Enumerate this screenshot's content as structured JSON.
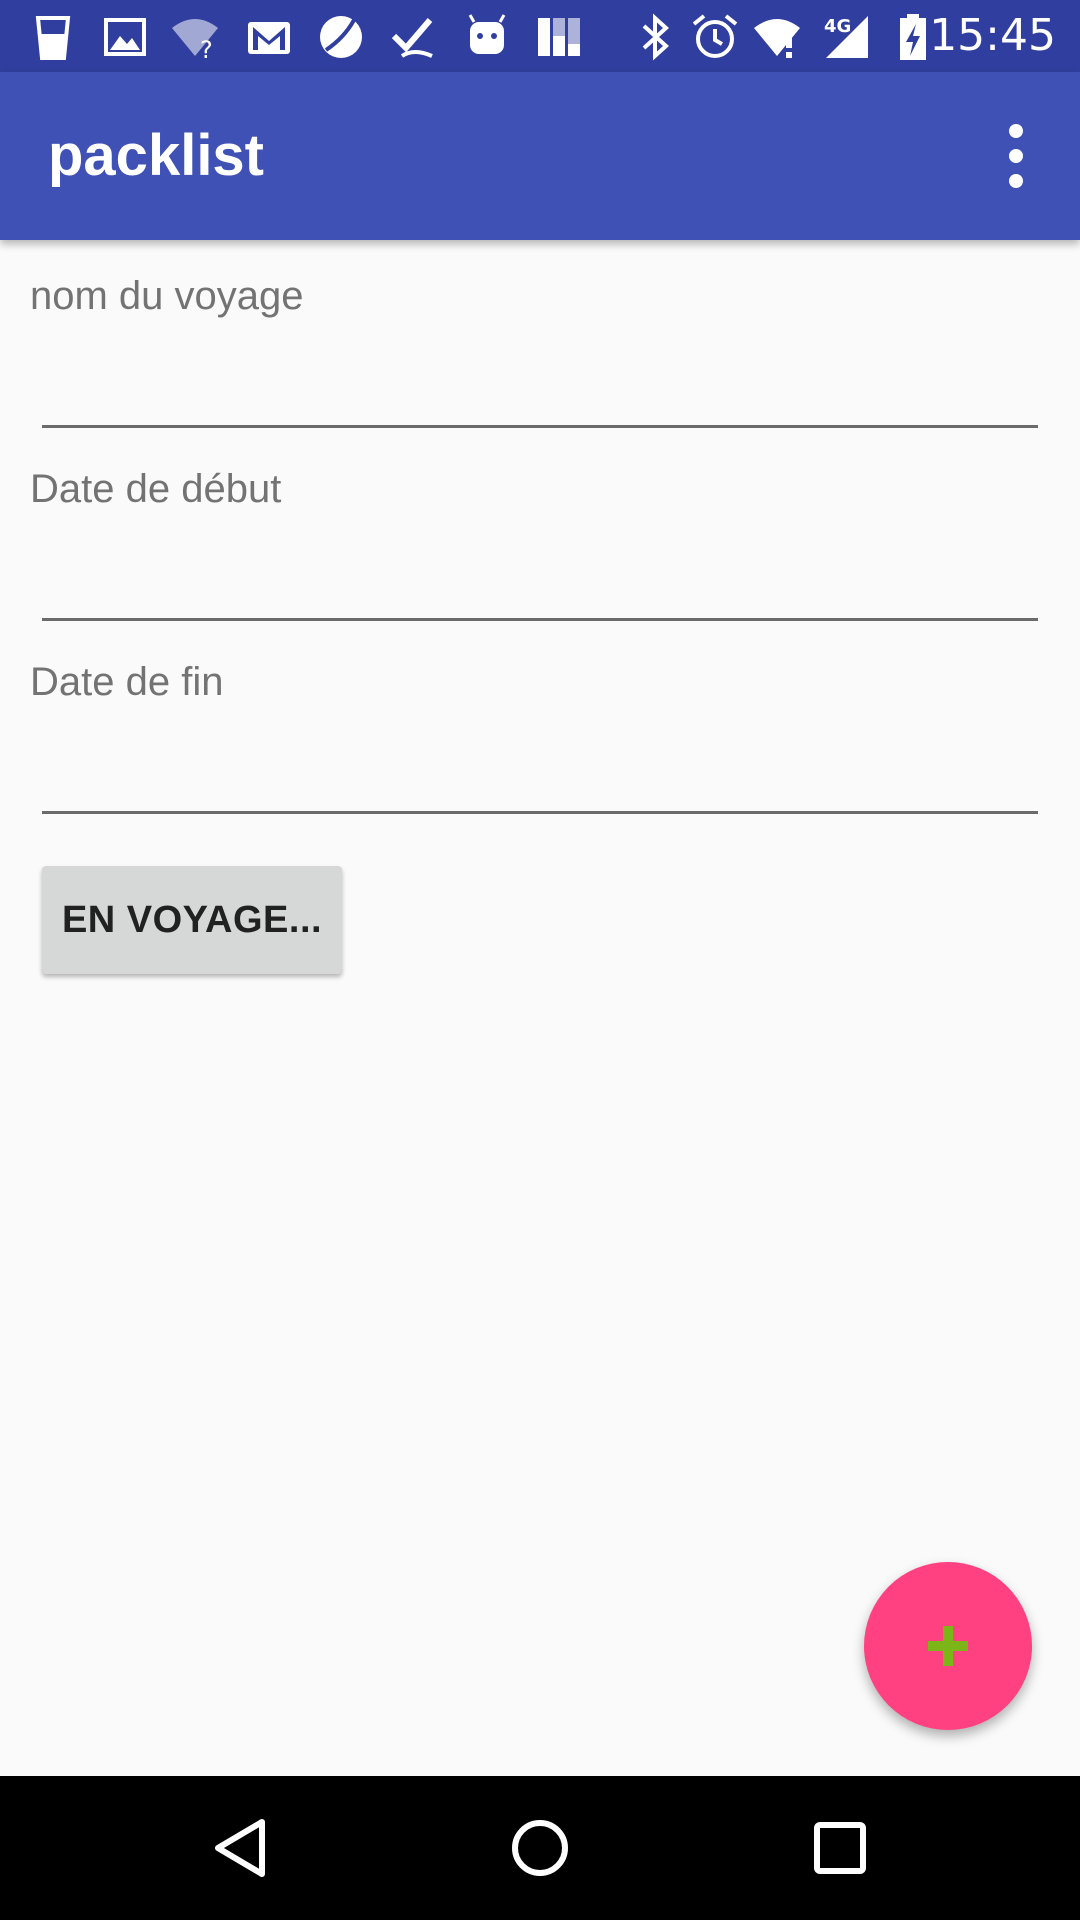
{
  "status_bar": {
    "time": "15:45",
    "network_label": "4G",
    "icons": [
      "cup-icon",
      "image-icon",
      "wifi-question-icon",
      "gmail-icon",
      "ball-icon",
      "check-icon",
      "android-icon",
      "chart-icon",
      "bluetooth-icon",
      "alarm-icon",
      "wifi-alert-icon",
      "signal-icon",
      "battery-charging-icon"
    ]
  },
  "app_bar": {
    "title": "packlist",
    "menu_icon": "more-vert-icon"
  },
  "form": {
    "trip_name_label": "nom du voyage",
    "trip_name_value": "",
    "start_date_label": "Date de début",
    "start_date_value": "",
    "end_date_label": "Date de fin",
    "end_date_value": "",
    "voyage_button_label": "EN VOYAGE..."
  },
  "fab": {
    "icon": "plus-icon",
    "background_color": "#ff4081",
    "icon_color": "#7cb518"
  },
  "nav_bar": {
    "icons": [
      "back-icon",
      "home-icon",
      "recents-icon"
    ]
  },
  "colors": {
    "status_bar": "#303f9f",
    "app_bar": "#3f51b5",
    "background": "#fafafa"
  }
}
